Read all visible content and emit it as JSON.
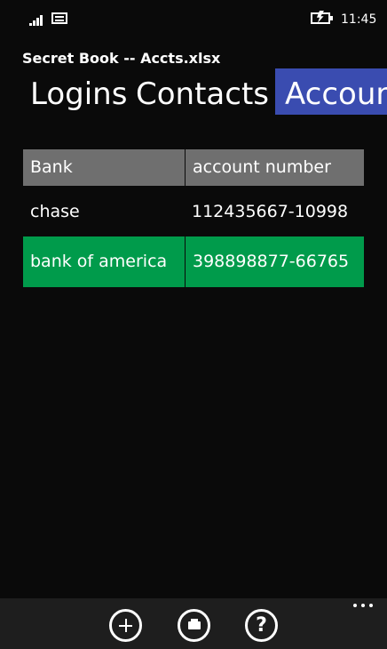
{
  "status_bar": {
    "time": "11:45"
  },
  "app": {
    "title": "Secret Book -- Accts.xlsx"
  },
  "pivot": {
    "tabs": [
      {
        "label": "Logins",
        "active": false
      },
      {
        "label": "Contacts",
        "active": false
      },
      {
        "label": "Account",
        "active": true
      }
    ]
  },
  "table": {
    "columns": [
      "Bank",
      "account number"
    ],
    "rows": [
      {
        "bank": "chase",
        "account": "112435667-10998",
        "selected": false
      },
      {
        "bank": "bank of america",
        "account": "398898877-66765",
        "selected": true
      }
    ]
  },
  "app_bar": {
    "buttons": [
      {
        "icon": "add-icon"
      },
      {
        "icon": "folder-icon"
      },
      {
        "icon": "help-icon",
        "glyph": "?"
      }
    ],
    "more_icon": "more-icon"
  },
  "colors": {
    "background": "#0a0a0a",
    "accent": "#3a4cb0",
    "selection": "#009b4b",
    "header": "#6f6f6f",
    "app_bar": "#1e1e1e"
  }
}
